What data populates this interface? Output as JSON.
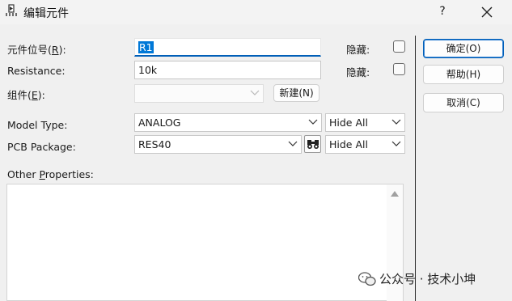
{
  "window": {
    "title": "编辑元件",
    "help_label": "?",
    "icon": "component-pin-icon",
    "close_icon": "close-icon"
  },
  "form": {
    "designator": {
      "label": "元件位号(",
      "hotkey": "R",
      "label_end": "):",
      "value": "R1"
    },
    "resistance": {
      "label": "Resistance:",
      "value": "10k"
    },
    "component": {
      "label": "组件(",
      "hotkey": "E",
      "label_end": "):",
      "value": ""
    },
    "hide_label_1": "隐藏:",
    "hide_label_2": "隐藏:",
    "new_button": "新建(N)",
    "model_type": {
      "label": "Model Type:",
      "value": "ANALOG",
      "visibility": "Hide All"
    },
    "pcb_package": {
      "label": "PCB Package:",
      "value": "RES40",
      "visibility": "Hide All",
      "browse_icon": "binoculars-icon"
    },
    "other_properties": {
      "label_pre": "Other ",
      "hotkey": "P",
      "label_post": "roperties:",
      "value": ""
    }
  },
  "buttons": {
    "ok": "确定(O)",
    "help": "帮助(H)",
    "cancel": "取消(C)"
  },
  "watermark": {
    "text": "公众号 · 技术小坤",
    "icon": "wechat-logo-icon"
  }
}
